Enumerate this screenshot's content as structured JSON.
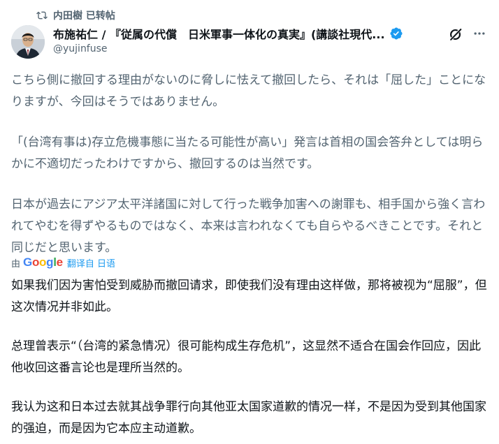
{
  "repost": {
    "label": "内田樹 已转帖"
  },
  "author": {
    "name": "布施祐仁 / 『従属の代償　日米軍事一体化の真実』(講談社現代...",
    "handle": "@yujinfuse"
  },
  "icons": {
    "repost": "repost-icon",
    "verified": "verified-badge-icon",
    "grok": "grok-icon",
    "more": "more-icon"
  },
  "colors": {
    "verified": "#1d9bf0",
    "link": "#1d9bf0",
    "secondary_text": "#536471"
  },
  "original_text": [
    "こちら側に撤回する理由がないのに脅しに怯えて撤回したら、それは「屈した」ことになりますが、今回はそうではありません。",
    "「(台湾有事は)存立危機事態に当たる可能性が高い」発言は首相の国会答弁としては明らかに不適切だったわけですから、撤回するのは当然です。",
    "日本が過去にアジア太平洋諸国に対して行った戦争加害への謝罪も、相手国から強く言われてやむを得ずやるものではなく、本来は言われなくても自らやるべきことです。それと同じだと思います。"
  ],
  "translation_bar": {
    "prefix": "由",
    "provider": "Google",
    "link": "翻译自 日语"
  },
  "translated_text": [
    "如果我们因为害怕受到威胁而撤回请求，即使我们没有理由这样做，那将被视为“屈服”，但这次情况并非如此。",
    "总理曾表示“（台湾的紧急情况）很可能构成生存危机”，这显然不适合在国会作回应，因此他收回这番言论也是理所当然的。",
    "我认为这和日本过去就其战争罪行向其他亚太国家道歉的情况一样，不是因为受到其他国家的强迫，而是因为它本应主动道歉。"
  ]
}
